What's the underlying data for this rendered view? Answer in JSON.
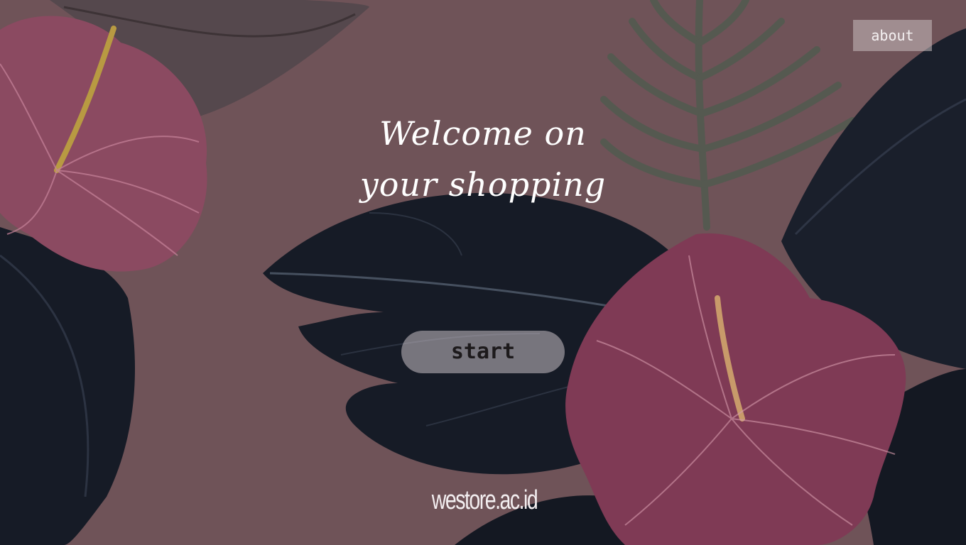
{
  "nav": {
    "about_label": "about"
  },
  "hero": {
    "title_line1": "Welcome on",
    "title_line2": "your shopping",
    "start_label": "start"
  },
  "footer": {
    "domain": "westore.ac.id"
  },
  "colors": {
    "background": "#6f5358",
    "leaf_dark": "#141a24",
    "flower": "#8a4a60",
    "text": "#ffffff"
  }
}
